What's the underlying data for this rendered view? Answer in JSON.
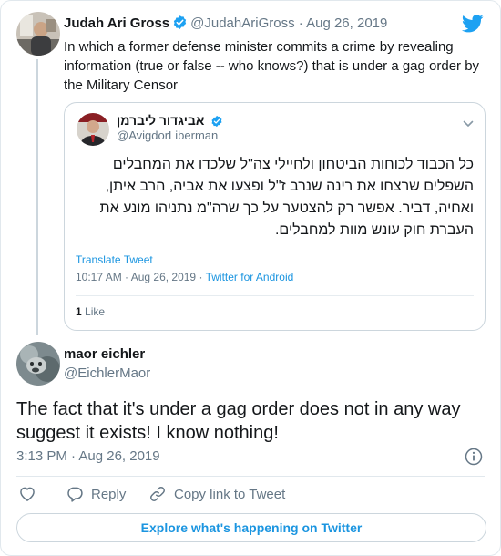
{
  "parent_tweet": {
    "display_name": "Judah Ari Gross",
    "handle": "@JudahAriGross",
    "separator": "·",
    "date": "Aug 26, 2019",
    "text": "In which a former defense minister commits a crime by revealing information (true or false -- who knows?) that is under a gag order by the Military Censor"
  },
  "quoted_tweet": {
    "display_name": "אביגדור ליברמן",
    "handle": "@AvigdorLiberman",
    "text": "כל הכבוד לכוחות הביטחון ולחיילי צה\"ל שלכדו את המחבלים השפלים שרצחו את רינה שנרב ז\"ל ופצעו את אביה, הרב איתן, ואחיה, דביר. אפשר רק להצטער על כך שרה\"מ נתניהו מונע את העברת חוק עונש מוות למחבלים.",
    "translate_label": "Translate Tweet",
    "time": "10:17 AM · Aug 26, 2019",
    "separator": "·",
    "source": "Twitter for Android",
    "likes_count": "1",
    "likes_label": "Like"
  },
  "main_tweet": {
    "display_name": "maor eichler",
    "handle": "@EichlerMaor",
    "text": "The fact that it's under a gag order does not in any way suggest it exists! I know nothing!",
    "timestamp": "3:13 PM · Aug 26, 2019"
  },
  "actions": {
    "reply_label": "Reply",
    "copy_link_label": "Copy link to Tweet"
  },
  "explore_label": "Explore what's happening on Twitter",
  "icons": {
    "verified": "verified-badge-icon",
    "brand": "twitter-bird-icon",
    "info": "info-icon",
    "like": "heart-icon",
    "reply": "speech-bubble-icon",
    "copy_link": "link-icon",
    "menu": "chevron-down-icon"
  },
  "colors": {
    "accent": "#1b95e0",
    "verified": "#1da1f2",
    "text_primary": "#14171a",
    "text_secondary": "#657786",
    "border": "#ccd6dd"
  }
}
